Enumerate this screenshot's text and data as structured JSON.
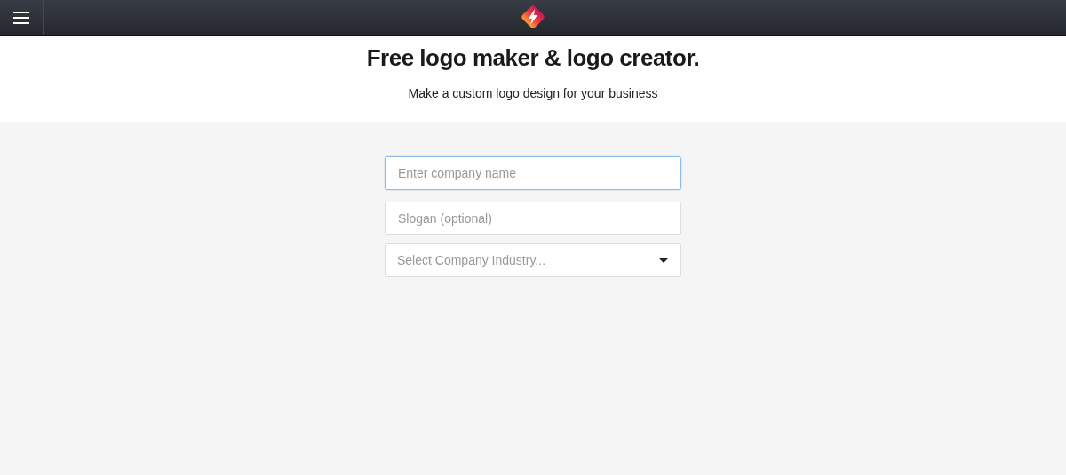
{
  "header": {
    "title": "Free logo maker & logo creator.",
    "subtitle": "Make a custom logo design for your business"
  },
  "fields": [
    {
      "kind": "text",
      "placeholder": "Enter company name",
      "focused": true
    },
    {
      "kind": "text",
      "placeholder": "Slogan (optional)",
      "focused": false
    },
    {
      "kind": "select",
      "placeholder": "Select Company Industry...",
      "focused": false
    }
  ]
}
